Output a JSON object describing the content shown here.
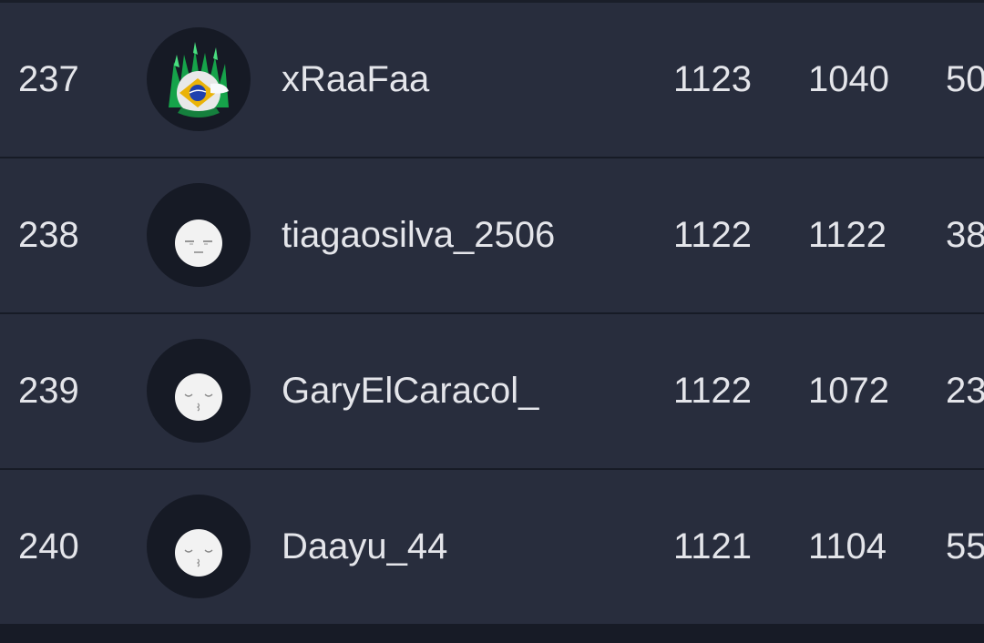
{
  "leaderboard": {
    "rows": [
      {
        "rank": "237",
        "username": "xRaaFaa",
        "stat1": "1123",
        "stat2": "1040",
        "stat3": "50",
        "avatar_icon": "custom-avatar-icon"
      },
      {
        "rank": "238",
        "username": "tiagaosilva_2506",
        "stat1": "1122",
        "stat2": "1122",
        "stat3": "38",
        "avatar_icon": "default-face-neutral-icon"
      },
      {
        "rank": "239",
        "username": "GaryElCaracol_",
        "stat1": "1122",
        "stat2": "1072",
        "stat3": "23",
        "avatar_icon": "default-face-kiss-icon"
      },
      {
        "rank": "240",
        "username": "Daayu_44",
        "stat1": "1121",
        "stat2": "1104",
        "stat3": "55",
        "avatar_icon": "default-face-kiss-icon"
      }
    ]
  },
  "colors": {
    "row_background": "#282d3d",
    "divider": "#171b26",
    "text": "#e4e5ea",
    "avatar_background": "#161a25",
    "avatar_face": "#f2f2f2",
    "avatar_accent_green": "#22c55e"
  }
}
